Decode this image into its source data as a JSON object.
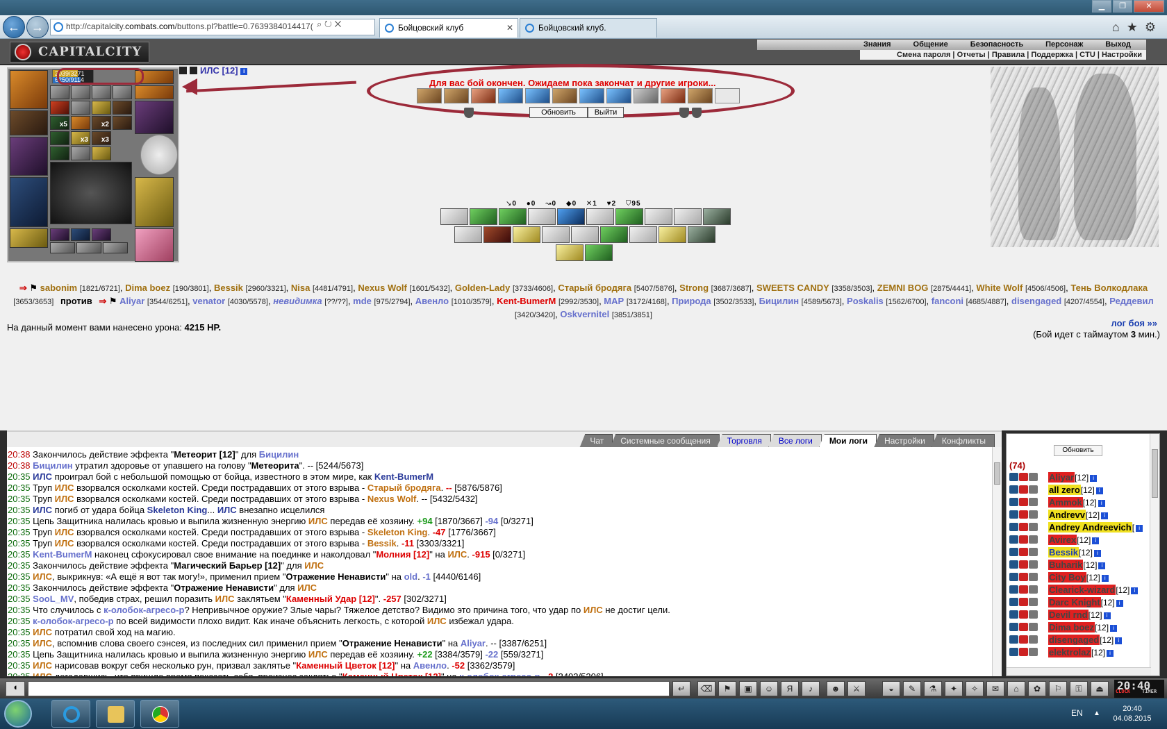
{
  "browser": {
    "url_prefix": "http://capitalcity.",
    "url_domain": "combats.com",
    "url_path": "/buttons.pl?battle=0.763938401441​7(",
    "tabs": [
      {
        "label": "Бойцовский клуб",
        "active": true
      },
      {
        "label": "Бойцовский клуб.",
        "active": false
      }
    ]
  },
  "game_header": {
    "logo": "CAPITALCITY",
    "menu": [
      "Знания",
      "Общение",
      "Безопасность",
      "Персонаж",
      "Выход"
    ],
    "submenu": "Смена пароля | Отчеты | Правила | Поддержка | CTU | Настройки"
  },
  "character": {
    "name": "ИЛС [12]",
    "hp": "2039/3271",
    "mp": "6250/9114",
    "hp_fraction": 0.62,
    "mp_fraction": 0.69,
    "counts": {
      "a": "x5",
      "b": "x2",
      "c": "x3",
      "d": "x3"
    }
  },
  "battle": {
    "end_message": "Для вас бой окончен. Ожидаем пока закончат и другие игроки...",
    "refresh_button": "Обновить",
    "exit_button": "Выйти",
    "stats": [
      "0",
      "0",
      "0",
      "0",
      "1",
      "2",
      "95"
    ],
    "damage_label": "На данный момент вами нанесено урона:",
    "damage_value": "4215 HP.",
    "log_link": "лог боя »»",
    "timeout_prefix": "(Бой идет с таймаутом",
    "timeout_value": "3",
    "timeout_suffix": "мин.)",
    "versus": "против"
  },
  "team_a": [
    {
      "name": "sabonim",
      "hp": "[1821/6721]"
    },
    {
      "name": "Dima boez",
      "hp": "[190/3801]"
    },
    {
      "name": "Bessik",
      "hp": "[2960/3321]"
    },
    {
      "name": "Nisa",
      "hp": "[4481/4791]"
    },
    {
      "name": "Nexus Wolf",
      "hp": "[1601/5432]"
    },
    {
      "name": "Golden-Lady",
      "hp": "[3733/4606]"
    },
    {
      "name": "Старый бродяга",
      "hp": "[5407/5876]"
    },
    {
      "name": "Strong",
      "hp": "[3687/3687]"
    },
    {
      "name": "SWEETS CANDY",
      "hp": "[3358/3503]"
    },
    {
      "name": "ZEMNI BOG",
      "hp": "[2875/4441]"
    },
    {
      "name": "White Wolf",
      "hp": "[4506/4506]"
    },
    {
      "name": "Тень Волкодлака",
      "hp": "[3653/3653]"
    }
  ],
  "team_b": [
    {
      "name": "Aliyar",
      "hp": "[3544/6251]",
      "style": "b"
    },
    {
      "name": "venator",
      "hp": "[4030/5578]",
      "style": "b"
    },
    {
      "name": "невидимка",
      "hp": "[??/??]",
      "style": "bi"
    },
    {
      "name": "mde",
      "hp": "[975/2794]",
      "style": "b"
    },
    {
      "name": "Авенло",
      "hp": "[1010/3579]",
      "style": "b"
    },
    {
      "name": "Kent-BumerM",
      "hp": "[2992/3530]",
      "style": "k"
    },
    {
      "name": "MAP",
      "hp": "[3172/4168]",
      "style": "b"
    },
    {
      "name": "Природа",
      "hp": "[3502/3533]",
      "style": "b"
    },
    {
      "name": "Бицилин",
      "hp": "[4589/5673]",
      "style": "b"
    },
    {
      "name": "Poskalis",
      "hp": "[1562/6700]",
      "style": "b"
    },
    {
      "name": "fanconi",
      "hp": "[4685/4887]",
      "style": "b"
    },
    {
      "name": "disengaged",
      "hp": "[4207/4554]",
      "style": "b"
    },
    {
      "name": "Реддевил",
      "hp": "[3420/3420]",
      "style": "b"
    },
    {
      "name": "Oskvernitel",
      "hp": "[3851/3851]",
      "style": "b"
    }
  ],
  "chat_tabs": [
    {
      "label": "Чат",
      "style": ""
    },
    {
      "label": "Системные сообщения",
      "style": ""
    },
    {
      "label": "Торговля",
      "style": "blue"
    },
    {
      "label": "Все логи",
      "style": "blue"
    },
    {
      "label": "Мои логи",
      "style": "active"
    },
    {
      "label": "Настройки",
      "style": ""
    },
    {
      "label": "Конфликты",
      "style": ""
    }
  ],
  "chat_lines": [
    [
      [
        "20:38",
        "tm"
      ],
      [
        " Закончилось действие эффекта \"",
        ""
      ],
      [
        "Метеорит [12]",
        "b"
      ],
      [
        "\" для ",
        ""
      ],
      [
        "Бицилин",
        "nb"
      ]
    ],
    [
      [
        "20:38",
        "tm"
      ],
      [
        " ",
        ""
      ],
      [
        "Бицилин",
        "nb"
      ],
      [
        " утратил здоровье от упавшего на голову \"",
        ""
      ],
      [
        "Метеорита",
        "b"
      ],
      [
        "\". -- [5244/5673]",
        ""
      ]
    ],
    [
      [
        "20:35",
        "tm"
      ],
      [
        " ",
        ""
      ],
      [
        "ИЛС",
        "nd"
      ],
      [
        " проиграл бой с небольшой помощью от бойца, известного в этом мире, как ",
        ""
      ],
      [
        "Kent-BumerM",
        "nd"
      ]
    ],
    [
      [
        "20:35",
        "tm"
      ],
      [
        " Труп ",
        ""
      ],
      [
        "ИЛС",
        "ils"
      ],
      [
        " взорвался осколками костей. Среди пострадавших от этого взрыва - ",
        ""
      ],
      [
        "Старый бродяга",
        "ils"
      ],
      [
        ". ",
        ""
      ],
      [
        "--",
        "pr"
      ],
      [
        " [5876/5876]",
        ""
      ]
    ],
    [
      [
        "20:35",
        "tm"
      ],
      [
        " Труп ",
        ""
      ],
      [
        "ИЛС",
        "ils"
      ],
      [
        " взорвался осколками костей. Среди пострадавших от этого взрыва - ",
        ""
      ],
      [
        "Nexus Wolf",
        "ils"
      ],
      [
        ". -- [5432/5432]",
        ""
      ]
    ],
    [
      [
        "20:35",
        "tm"
      ],
      [
        " ",
        ""
      ],
      [
        "ИЛС",
        "nd"
      ],
      [
        " погиб от удара бойца ",
        ""
      ],
      [
        "Skeleton King",
        "nd"
      ],
      [
        "... ",
        ""
      ],
      [
        "ИЛС",
        "nd"
      ],
      [
        " внезапно исцелился",
        ""
      ]
    ],
    [
      [
        "20:35",
        "tm"
      ],
      [
        " Цепь Защитника налилась кровью и выпила жизненную энергию ",
        ""
      ],
      [
        "ИЛС",
        "ils"
      ],
      [
        " передав её хозяину. ",
        ""
      ],
      [
        "+94",
        "pg"
      ],
      [
        " [1870/3667] ",
        ""
      ],
      [
        "-94",
        "nb"
      ],
      [
        " [0/3271]",
        ""
      ]
    ],
    [
      [
        "20:35",
        "tm"
      ],
      [
        " Труп ",
        ""
      ],
      [
        "ИЛС",
        "ils"
      ],
      [
        " взорвался осколками костей. Среди пострадавших от этого взрыва - ",
        ""
      ],
      [
        "Skeleton King",
        "ils"
      ],
      [
        ". ",
        ""
      ],
      [
        "-47",
        "pr"
      ],
      [
        " [1776/3667]",
        ""
      ]
    ],
    [
      [
        "20:35",
        "tm"
      ],
      [
        " Труп ",
        ""
      ],
      [
        "ИЛС",
        "ils"
      ],
      [
        " взорвался осколками костей. Среди пострадавших от этого взрыва - ",
        ""
      ],
      [
        "Bessik",
        "ils"
      ],
      [
        ". ",
        ""
      ],
      [
        "-11",
        "pr"
      ],
      [
        " [3303/3321]",
        ""
      ]
    ],
    [
      [
        "20:35",
        "tm"
      ],
      [
        " ",
        ""
      ],
      [
        "Kent-BumerM",
        "nb"
      ],
      [
        " наконец сфокусировал свое внимание на поединке и наколдовал \"",
        ""
      ],
      [
        "Молния [12]",
        "pr"
      ],
      [
        "\" на ",
        ""
      ],
      [
        "ИЛС",
        "ils"
      ],
      [
        ". ",
        ""
      ],
      [
        "-915",
        "pr"
      ],
      [
        " [0/3271]",
        ""
      ]
    ],
    [
      [
        "20:35",
        "tm"
      ],
      [
        " Закончилось действие эффекта \"",
        ""
      ],
      [
        "Магический Барьер [12]",
        "b"
      ],
      [
        "\" для ",
        ""
      ],
      [
        "ИЛС",
        "ils"
      ]
    ],
    [
      [
        "20:35",
        "tm"
      ],
      [
        " ",
        ""
      ],
      [
        "ИЛС",
        "ils"
      ],
      [
        ", выкрикнув: «А ещё я вот так могу!», применил прием \"",
        ""
      ],
      [
        "Отражение Ненависти",
        "b"
      ],
      [
        "\" на ",
        ""
      ],
      [
        "old",
        "nb"
      ],
      [
        ". ",
        ""
      ],
      [
        "-1",
        "nb"
      ],
      [
        " [4440/6146]",
        ""
      ]
    ],
    [
      [
        "20:35",
        "tm"
      ],
      [
        " Закончилось действие эффекта \"",
        ""
      ],
      [
        "Отражение Ненависти",
        "b"
      ],
      [
        "\" для ",
        ""
      ],
      [
        "ИЛС",
        "ils"
      ]
    ],
    [
      [
        "20:35",
        "tm"
      ],
      [
        " ",
        ""
      ],
      [
        "SooL_MV",
        "nb"
      ],
      [
        ", победив страх, решил поразить ",
        ""
      ],
      [
        "ИЛС",
        "ils"
      ],
      [
        " заклятьем \"",
        ""
      ],
      [
        "Каменный Удар [12]",
        "pr"
      ],
      [
        "\". ",
        ""
      ],
      [
        "-257",
        "pr"
      ],
      [
        " [302/3271]",
        ""
      ]
    ],
    [
      [
        "20:35",
        "tm"
      ],
      [
        " Что случилось с ",
        ""
      ],
      [
        "к-олобок-агресо-р",
        "nb"
      ],
      [
        "? Непривычное оружие? Злые чары? Тяжелое детство? Видимо это причина того, что удар по ",
        ""
      ],
      [
        "ИЛС",
        "ils"
      ],
      [
        " не достиг цели.",
        ""
      ]
    ],
    [
      [
        "20:35",
        "tm"
      ],
      [
        " ",
        ""
      ],
      [
        "к-олобок-агресо-р",
        "nb"
      ],
      [
        " по всей видимости плохо видит. Как иначе объяснить легкость, с которой ",
        ""
      ],
      [
        "ИЛС",
        "ils"
      ],
      [
        " избежал удара.",
        ""
      ]
    ],
    [
      [
        "20:35",
        "tm"
      ],
      [
        " ",
        ""
      ],
      [
        "ИЛС",
        "ils"
      ],
      [
        " потратил свой ход на магию.",
        ""
      ]
    ],
    [
      [
        "20:35",
        "tm"
      ],
      [
        " ",
        ""
      ],
      [
        "ИЛС",
        "ils"
      ],
      [
        ", вспомнив слова своего сэнсея, из последних сил применил прием \"",
        ""
      ],
      [
        "Отражение Ненависти",
        "b"
      ],
      [
        "\" на ",
        ""
      ],
      [
        "Aliyar",
        "nb"
      ],
      [
        ". -- [3387/6251]",
        ""
      ]
    ],
    [
      [
        "20:35",
        "tm"
      ],
      [
        " Цепь Защитника налилась кровью и выпила жизненную энергию ",
        ""
      ],
      [
        "ИЛС",
        "ils"
      ],
      [
        " передав её хозяину. ",
        ""
      ],
      [
        "+22",
        "pg"
      ],
      [
        " [3384/3579] ",
        ""
      ],
      [
        "-22",
        "nb"
      ],
      [
        " [559/3271]",
        ""
      ]
    ],
    [
      [
        "20:35",
        "tm"
      ],
      [
        " ",
        ""
      ],
      [
        "ИЛС",
        "ils"
      ],
      [
        " нарисовав вокруг себя несколько рун, призвал заклятье \"",
        ""
      ],
      [
        "Каменный Цветок [12]",
        "pr"
      ],
      [
        "\" на ",
        ""
      ],
      [
        "Авенло",
        "nb"
      ],
      [
        ". ",
        ""
      ],
      [
        "-52",
        "pr"
      ],
      [
        " [3362/3579]",
        ""
      ]
    ],
    [
      [
        "20:35",
        "tm"
      ],
      [
        " ",
        ""
      ],
      [
        "ИЛС",
        "ils"
      ],
      [
        " догадавшись, что пришло время показать себя, произнес заклятье \"",
        ""
      ],
      [
        "Каменный Цветок [12]",
        "pr"
      ],
      [
        "\" на ",
        ""
      ],
      [
        "к-олобок-агресо-р",
        "nb"
      ],
      [
        ". ",
        ""
      ],
      [
        "-2",
        "pr"
      ],
      [
        " [3402/5206]",
        ""
      ]
    ]
  ],
  "online": {
    "refresh": "Обновить",
    "count": "(74)",
    "users": [
      {
        "name": "Aliyar",
        "level": "[12]",
        "style": "red"
      },
      {
        "name": "all zero",
        "level": "[12]",
        "style": "yel"
      },
      {
        "name": "Ammok",
        "level": "[12]",
        "style": "red"
      },
      {
        "name": "Andrevv",
        "level": "[12]",
        "style": "yel"
      },
      {
        "name": "Andrey Andreevich",
        "level": "[",
        "style": "yel"
      },
      {
        "name": "Avirex",
        "level": "[12]",
        "style": "red"
      },
      {
        "name": "Bessik",
        "level": "[12]",
        "style": "blu"
      },
      {
        "name": "Buharik",
        "level": "[12]",
        "style": "red"
      },
      {
        "name": "City Boy",
        "level": "[12]",
        "style": "red"
      },
      {
        "name": "Clearick-wizard",
        "level": "[12]",
        "style": "red"
      },
      {
        "name": "Darc Knight",
        "level": "[12]",
        "style": "red"
      },
      {
        "name": "Devil rnd",
        "level": "[12]",
        "style": "red"
      },
      {
        "name": "Dima boez",
        "level": "[12]",
        "style": "red"
      },
      {
        "name": "disengaged",
        "level": "[12]",
        "style": "red"
      },
      {
        "name": "elektrolaz",
        "level": "[12]",
        "style": "red"
      }
    ]
  },
  "game_clock": {
    "time": "20:40",
    "clock_label": "CLOCK",
    "timer_label": "TIMER"
  },
  "taskbar": {
    "lang": "EN",
    "time": "20:40",
    "date": "04.08.2015"
  },
  "icons": [
    "back-icon",
    "forward-icon",
    "search-icon",
    "refresh-icon",
    "home-icon",
    "star-icon",
    "gear-icon"
  ]
}
